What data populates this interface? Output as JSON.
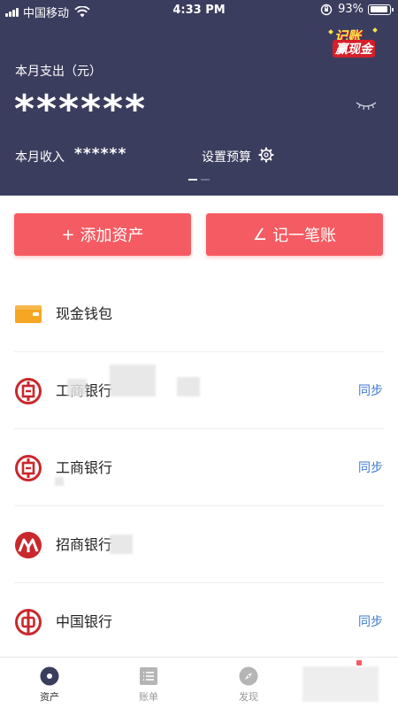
{
  "status_bar": {
    "carrier": "中国移动",
    "time": "4:33 PM",
    "battery": "93%",
    "battery_level": 0.93
  },
  "promo": {
    "line1": "记账",
    "line2": "赢现金"
  },
  "summary": {
    "expense_label": "本月支出（元）",
    "expense_value": "******",
    "income_label": "本月收入",
    "income_value": "******",
    "budget_label": "设置预算"
  },
  "actions": {
    "add_asset": "添加资产",
    "add_asset_glyph": "+",
    "record": "记一笔账",
    "record_glyph": "∠"
  },
  "accounts": [
    {
      "name": "现金钱包",
      "icon": "wallet-icon",
      "action": ""
    },
    {
      "name": "工商银行",
      "icon": "icbc-logo-icon",
      "action": "同步"
    },
    {
      "name": "工商银行",
      "icon": "icbc-logo-icon",
      "action": "同步"
    },
    {
      "name": "招商银行",
      "icon": "cmb-logo-icon",
      "action": ""
    },
    {
      "name": "中国银行",
      "icon": "boc-logo-icon",
      "action": "同步"
    }
  ],
  "tabs": [
    {
      "label": "资产",
      "icon": "asset-icon",
      "active": true
    },
    {
      "label": "账单",
      "icon": "bill-list-icon",
      "active": false
    },
    {
      "label": "发现",
      "icon": "compass-icon",
      "active": false
    }
  ],
  "colors": {
    "header_bg": "#3b3d5e",
    "accent_red": "#f55b62",
    "link_blue": "#3e7ad2",
    "wallet_orange": "#f6a623",
    "bank_red": "#c9282d"
  }
}
